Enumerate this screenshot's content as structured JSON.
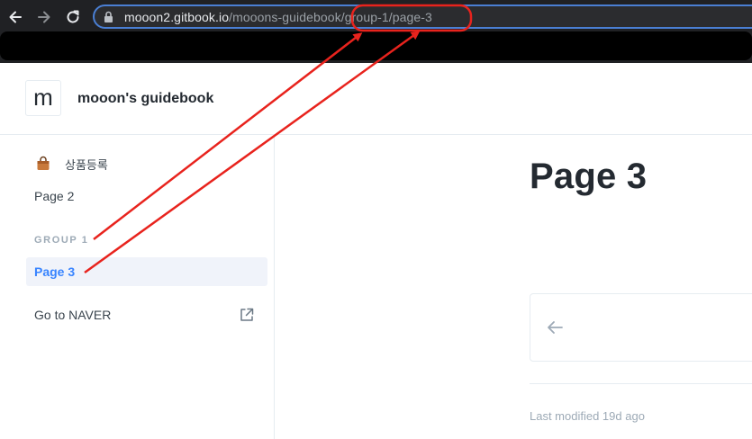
{
  "browser": {
    "url_host": "mooon2.gitbook.io",
    "url_path": "/mooons-guidebook/group-1/page-3",
    "icons": [
      "back-arrow-icon",
      "forward-arrow-icon",
      "reload-icon",
      "lock-icon"
    ]
  },
  "header": {
    "logo_letter": "m",
    "space_title": "mooon's guidebook"
  },
  "sidebar": {
    "items": [
      {
        "label": "상품등록",
        "icon": "shopping-bag-emoji-icon"
      },
      {
        "label": "Page 2"
      }
    ],
    "group_label": "GROUP 1",
    "active_item": "Page 3",
    "external_link": {
      "label": "Go to NAVER",
      "icon": "external-link-icon"
    }
  },
  "main": {
    "title": "Page 3",
    "prev_icon": "left-arrow-icon",
    "last_modified": "Last modified 19d ago"
  },
  "colors": {
    "accent": "#3884ff",
    "annotation": "#e8231d",
    "chrome_bg": "#202124",
    "omnibox_border": "#4a7fd4"
  }
}
